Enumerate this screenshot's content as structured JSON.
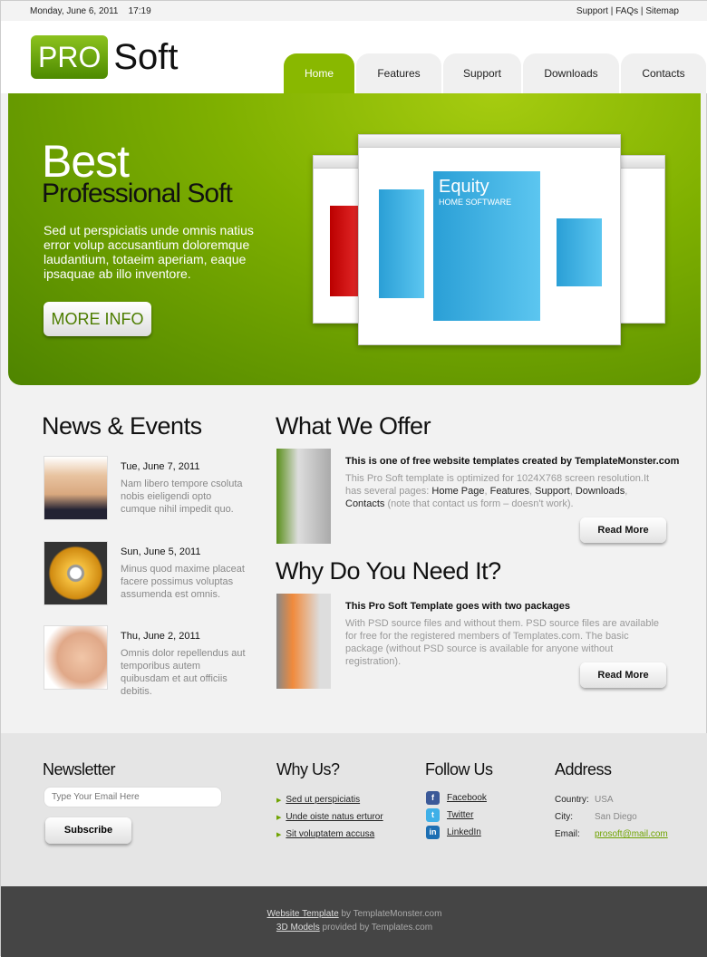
{
  "topbar": {
    "date": "Monday, June 6, 2011",
    "time": "17:19",
    "links": [
      "Support",
      "FAQs",
      "Sitemap"
    ],
    "sep": "|"
  },
  "logo": {
    "pro": "PRO",
    "soft": "Soft"
  },
  "nav": [
    {
      "label": "Home",
      "active": true
    },
    {
      "label": "Features"
    },
    {
      "label": "Support"
    },
    {
      "label": "Downloads"
    },
    {
      "label": "Contacts"
    }
  ],
  "hero": {
    "title": "Best",
    "subtitle": "Professional Soft",
    "text": "Sed ut perspiciatis unde omnis natius error volup accusantium doloremque laudantium, totaeim aperiam, eaque ipsaquae ab illo inventore.",
    "button": "MORE INFO",
    "box_brand": "Equity",
    "box_sub": "HOME SOFTWARE"
  },
  "news": {
    "title": "News & Events",
    "items": [
      {
        "date": "Tue, June 7, 2011",
        "text": "Nam libero tempore csoluta nobis eieligendi opto cumque nihil impedit quo."
      },
      {
        "date": "Sun, June 5, 2011",
        "text": "Minus quod maxime placeat facere possimus voluptas assumenda est omnis."
      },
      {
        "date": "Thu, June 2, 2011",
        "text": "Omnis dolor repellendus aut temporibus autem quibusdam et aut officiis debitis."
      }
    ]
  },
  "offer": {
    "title": "What We Offer",
    "heading": "This is one of free website templates created by TemplateMonster.com",
    "text_before": "This Pro Soft template is optimized for 1024X768 screen resolution.It has several pages: ",
    "links": [
      "Home Page",
      "Features",
      "Support",
      "Downloads",
      "Contacts"
    ],
    "text_after": " (note that contact us form – doesn't work).",
    "button": "Read More"
  },
  "why": {
    "title": "Why Do You Need It?",
    "heading": "This Pro Soft Template goes with two packages",
    "text": "With PSD source files and without them. PSD source files are available for free for the registered members of Templates.com. The basic package (without PSD source is available for anyone without registration).",
    "button": "Read More"
  },
  "footer": {
    "newsletter": {
      "title": "Newsletter",
      "placeholder": "Type Your Email Here",
      "button": "Subscribe"
    },
    "why_us": {
      "title": "Why Us?",
      "items": [
        "Sed ut perspiciatis",
        "Unde oiste natus erturor",
        "Sit voluptatem accusa"
      ]
    },
    "follow": {
      "title": "Follow Us",
      "items": [
        {
          "label": "Facebook",
          "icon": "facebook-icon",
          "color": "#3b5998"
        },
        {
          "label": "Twitter",
          "icon": "twitter-icon",
          "color": "#3fb0e8"
        },
        {
          "label": "LinkedIn",
          "icon": "linkedin-icon",
          "color": "#1d6fb3"
        }
      ]
    },
    "address": {
      "title": "Address",
      "country_label": "Country:",
      "country": "USA",
      "city_label": "City:",
      "city": "San Diego",
      "email_label": "Email:",
      "email": "prosoft@mail.com"
    }
  },
  "credits": {
    "line1_link": "Website Template",
    "line1_text": " by TemplateMonster.com",
    "line2_link": "3D Models",
    "line2_text": " provided by Templates.com"
  },
  "colors": {
    "accent": "#89b800",
    "dark_green": "#4e8400",
    "footer_bg": "#454545"
  }
}
